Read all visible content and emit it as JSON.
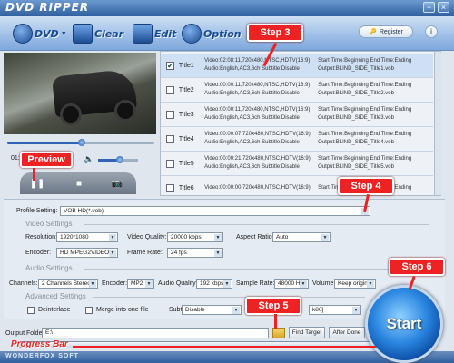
{
  "app": {
    "title": "DVD RIPPER",
    "brand": "WONDERFOX SOFT"
  },
  "toolbar": {
    "dvd": "DVD",
    "clear": "Clear",
    "edit": "Edit",
    "option": "Option",
    "register": "Register",
    "info": "i"
  },
  "window": {
    "minimize": "−",
    "close": "×"
  },
  "player": {
    "time": "01:0",
    "play": "❚❚",
    "stop": "■",
    "snapshot": "📷"
  },
  "titles": [
    {
      "name": "Title1",
      "checked": true,
      "line1": "Video:02:08:11,720x480,NTSC,HDTV(16:9)",
      "line2": "Audio:English,AC3,6ch Subtitle:Disable",
      "out1": "Start Time:Beginning End Time:Ending",
      "out2": "Output:BLIND_SIDE_Title1.vob"
    },
    {
      "name": "Title2",
      "checked": false,
      "line1": "Video:00:00:11,720x480,NTSC,HDTV(16:9)",
      "line2": "Audio:English,AC3,6ch Subtitle:Disable",
      "out1": "Start Time:Beginning End Time:Ending",
      "out2": "Output:BLIND_SIDE_Title2.vob"
    },
    {
      "name": "Title3",
      "checked": false,
      "line1": "Video:00:00:11,720x480,NTSC,HDTV(16:9)",
      "line2": "Audio:English,AC3,6ch Subtitle:Disable",
      "out1": "Start Time:Beginning End Time:Ending",
      "out2": "Output:BLIND_SIDE_Title3.vob"
    },
    {
      "name": "Title4",
      "checked": false,
      "line1": "Video:00:00:07,720x480,NTSC,HDTV(16:9)",
      "line2": "Audio:English,AC3,6ch Subtitle:Disable",
      "out1": "Start Time:Beginning End Time:Ending",
      "out2": "Output:BLIND_SIDE_Title4.vob"
    },
    {
      "name": "Title5",
      "checked": false,
      "line1": "Video:00:00:21,720x480,NTSC,HDTV(16:9)",
      "line2": "Audio:English,AC3,6ch Subtitle:Disable",
      "out1": "Start Time:Beginning End Time:Ending",
      "out2": "Output:BLIND_SIDE_Title5.vob"
    },
    {
      "name": "Title6",
      "checked": false,
      "line1": "Video:00:00:00,720x480,NTSC,HDTV(16:9)",
      "line2": "",
      "out1": "Start Time:Beginning End Time:Ending",
      "out2": ""
    }
  ],
  "settings": {
    "profile_label": "Profile Setting:",
    "profile_value": "VOB HD(*.vob)",
    "video_section": "Video Settings",
    "resolution_label": "Resolution:",
    "resolution": "1920*1080",
    "video_quality_label": "Video Quality:",
    "video_quality": "20000 kbps",
    "aspect_label": "Aspect Ratio:",
    "aspect": "Auto",
    "encoder_label": "Encoder:",
    "encoder": "HD MPEG2VIDEO",
    "framerate_label": "Frame Rate:",
    "framerate": "24 fps",
    "audio_section": "Audio Settings",
    "channels_label": "Channels:",
    "channels": "2 Channels Stereo",
    "aencoder_label": "Encoder:",
    "aencoder": "MP2",
    "aquality_label": "Audio Quality:",
    "aquality": "192 kbps",
    "samplerate_label": "Sample Rate:",
    "samplerate": "48000 Hz",
    "volume_label": "Volume:",
    "volume": "Keep origina",
    "advanced_section": "Advanced Settings",
    "deinterlace": "Deinterlace",
    "merge": "Merge into one file",
    "subtitle_label": "Subtitle:",
    "subtitle": "Disable",
    "audio_track_tail": "k80]",
    "output_label": "Output Folder:",
    "output_value": "E:\\",
    "find_target": "Find Target",
    "after_done": "After Done"
  },
  "start": "Start",
  "callouts": {
    "step3": "Step 3",
    "step4": "Step 4",
    "step5": "Step 5",
    "step6": "Step 6",
    "preview": "Preview",
    "progress": "Progress Bar"
  },
  "colors": {
    "accent": "#2f5f9e",
    "callout": "#ee2222"
  }
}
